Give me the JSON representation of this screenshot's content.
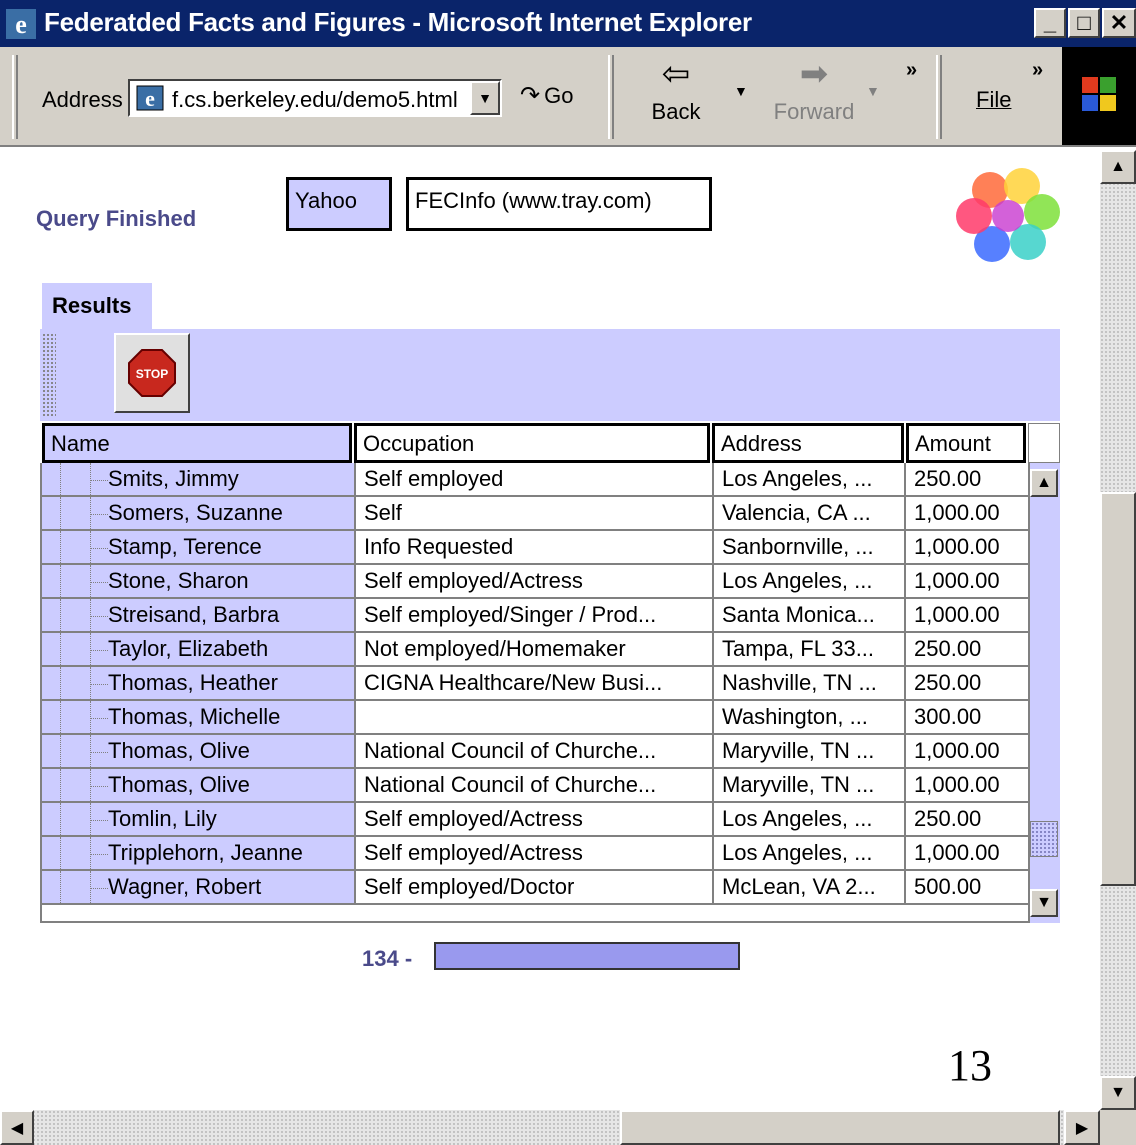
{
  "window": {
    "title": "Federatded Facts and Figures - Microsoft Internet Explorer",
    "controls": [
      "_",
      "□",
      "✕"
    ]
  },
  "toolbar": {
    "address_label": "Address",
    "url": "f.cs.berkeley.edu/demo5.html",
    "go_label": "Go",
    "back_label": "Back",
    "forward_label": "Forward",
    "chevron": "»",
    "file_label": "File"
  },
  "content": {
    "status": "Query Finished",
    "sources": [
      "Yahoo",
      "FECInfo (www.tray.com)"
    ],
    "tab_label": "Results",
    "stop_label": "STOP",
    "columns": [
      "Name",
      "Occupation",
      "Address",
      "Amount"
    ],
    "rows": [
      [
        "Smits, Jimmy",
        "Self employed",
        "Los Angeles, ...",
        "250.00"
      ],
      [
        "Somers, Suzanne",
        "Self",
        "Valencia, CA ...",
        "1,000.00"
      ],
      [
        "Stamp, Terence",
        "Info Requested",
        "Sanbornville, ...",
        "1,000.00"
      ],
      [
        "Stone, Sharon",
        "Self employed/Actress",
        "Los Angeles, ...",
        "1,000.00"
      ],
      [
        "Streisand, Barbra",
        "Self employed/Singer / Prod...",
        "Santa Monica...",
        "1,000.00"
      ],
      [
        "Taylor, Elizabeth",
        "Not employed/Homemaker",
        "Tampa, FL 33...",
        "250.00"
      ],
      [
        "Thomas, Heather",
        "CIGNA Healthcare/New Busi...",
        "Nashville, TN ...",
        "250.00"
      ],
      [
        "Thomas, Michelle",
        "",
        "Washington, ...",
        "300.00"
      ],
      [
        "Thomas, Olive",
        "National Council of Churche...",
        "Maryville, TN ...",
        "1,000.00"
      ],
      [
        "Thomas, Olive",
        "National Council of Churche...",
        "Maryville, TN ...",
        "1,000.00"
      ],
      [
        "Tomlin, Lily",
        "Self employed/Actress",
        "Los Angeles, ...",
        "250.00"
      ],
      [
        "Tripplehorn, Jeanne",
        "Self employed/Actress",
        "Los Angeles, ...",
        "1,000.00"
      ],
      [
        "Wagner, Robert",
        "Self employed/Doctor",
        "McLean, VA 2...",
        "500.00"
      ]
    ],
    "result_count": "134 -",
    "progress": 1.0,
    "page_number": "13"
  },
  "colors": {
    "titlebar": "#0a246a",
    "chrome": "#d4d0c8",
    "accent": "#ccccff",
    "progress_fill": "#9999ee"
  }
}
